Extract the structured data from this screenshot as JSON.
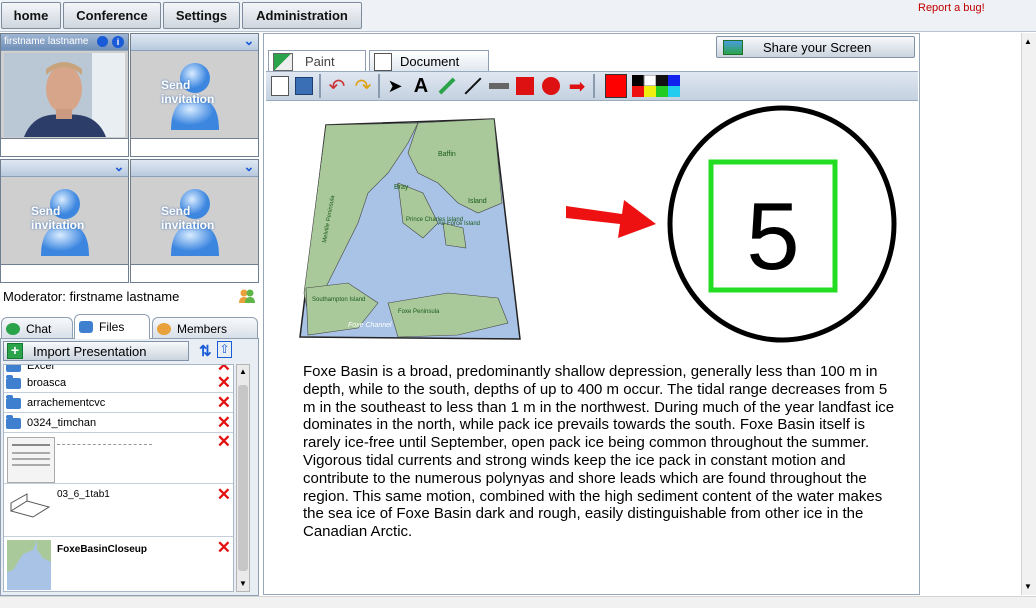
{
  "nav": {
    "home": "home",
    "conference": "Conference",
    "settings": "Settings",
    "administration": "Administration",
    "report_bug": "Report a bug!"
  },
  "videos": [
    {
      "label": "firstname lastname",
      "type": "camera"
    },
    {
      "label": "Send invitation",
      "type": "invite"
    },
    {
      "label": "Send invitation",
      "type": "invite"
    },
    {
      "label": "Send invitation",
      "type": "invite"
    }
  ],
  "moderator": "Moderator: firstname lastname",
  "left_tabs": {
    "chat": "Chat",
    "files": "Files",
    "members": "Members"
  },
  "files": {
    "import_label": "Import Presentation",
    "folders": [
      "Excel",
      "broasca",
      "arrachementcvc",
      "0324_timchan"
    ],
    "documents": [
      "",
      "03_6_1tab1",
      "FoxeBasinCloseup"
    ]
  },
  "main_tabs": {
    "paint": "Paint",
    "document": "Document"
  },
  "share_label": "Share your Screen",
  "map_labels": {
    "baffin": "Baffin",
    "island": "Island",
    "bray": "Bray",
    "prince_charles": "Prince Charles Island",
    "air_force": "Air Force Island",
    "melville": "Melville Peninsula",
    "southampton": "Southampton Island",
    "foxe_channel": "Foxe Channel",
    "foxe_peninsula": "Foxe Peninsula"
  },
  "drawing_number": "5",
  "paragraph": "Foxe Basin is a broad, predominantly shallow depression, generally less than 100 m in depth, while to the south, depths of up to 400 m occur. The tidal range decreases from 5 m in the southeast to less than 1 m in the northwest. During much of the year landfast ice dominates in the north, while pack ice prevails towards the south. Foxe Basin itself is rarely ice-free until September, open pack ice being common throughout the summer. Vigorous tidal currents and strong winds keep the ice pack in constant motion and contribute to the numerous polynyas and shore leads which are found throughout the region. This same motion, combined with the high sediment content of the water makes the sea ice of Foxe Basin dark and rough, easily distinguishable from other ice in the Canadian Arctic.",
  "colors": {
    "accent": "#1a5bd8",
    "delete": "#e21212",
    "drawing_green": "#22dd22",
    "arrow_red": "#ee1111",
    "current_color": "#ff0000"
  }
}
